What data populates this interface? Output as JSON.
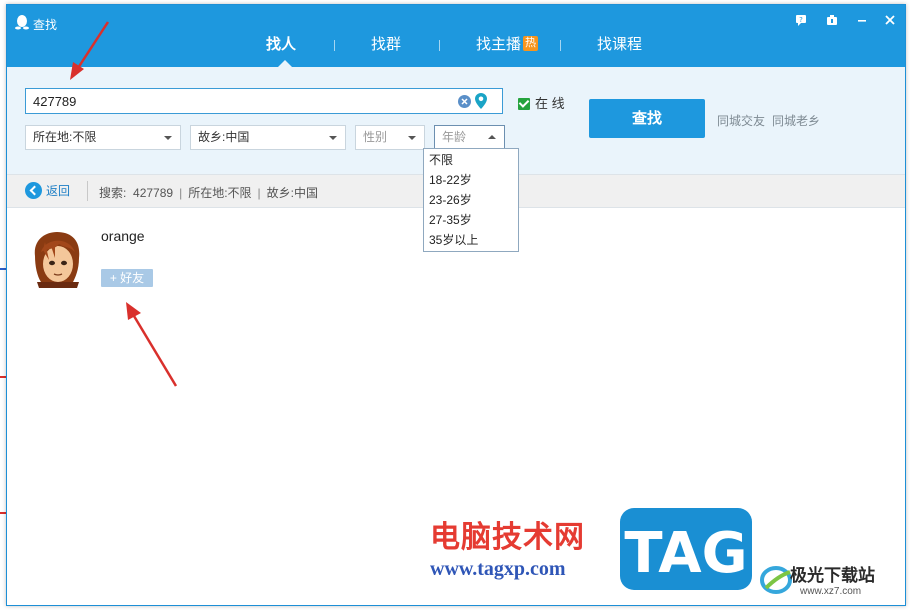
{
  "window": {
    "title": "查找"
  },
  "tabs": [
    {
      "label": "找人",
      "active": true
    },
    {
      "label": "找群",
      "active": false
    },
    {
      "label": "找主播",
      "active": false,
      "badge": "热"
    },
    {
      "label": "找课程",
      "active": false
    }
  ],
  "search": {
    "value": "427789",
    "online_label": "在 线",
    "online_checked": true,
    "button_label": "查找",
    "links": [
      "同城交友",
      "同城老乡"
    ]
  },
  "filters": {
    "location": "所在地:不限",
    "hometown": "故乡:中国",
    "gender_placeholder": "性别",
    "age_placeholder": "年龄",
    "age_options": [
      "不限",
      "18-22岁",
      "23-26岁",
      "27-35岁",
      "35岁以上"
    ]
  },
  "breadcrumb": {
    "back_label": "返回",
    "prefix": "搜索:",
    "query": "427789",
    "location": "所在地:不限",
    "hometown": "故乡:中国"
  },
  "result": {
    "nickname": "orange",
    "add_label": "+ 好友"
  },
  "watermark": {
    "cn": "电脑技术网",
    "url": "www.tagxp.com",
    "tag": "TAG",
    "site_cn": "极光下载站",
    "site_url": "www.xz7.com"
  },
  "colors": {
    "accent": "#1e98de",
    "panel": "#eaf4fb",
    "arrow": "#d9302c"
  }
}
